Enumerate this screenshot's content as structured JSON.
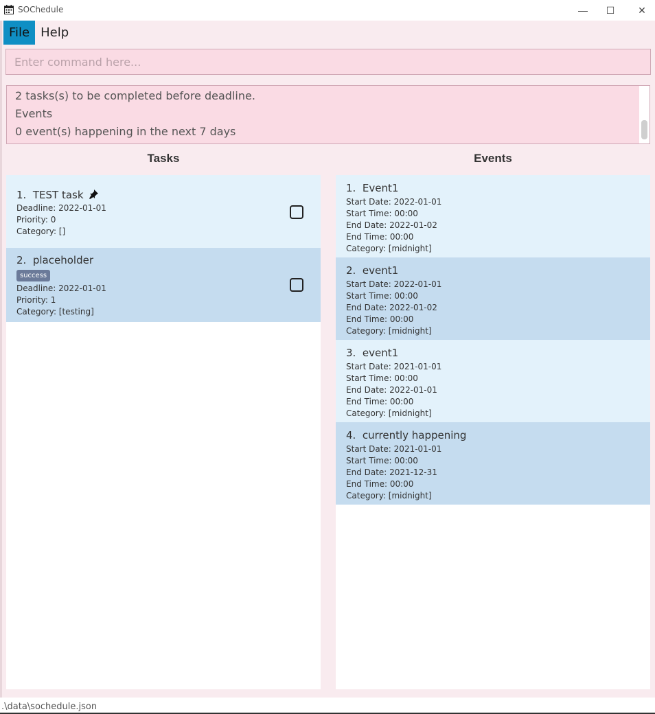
{
  "window": {
    "title": "SOChedule",
    "minimize": "—",
    "maximize": "☐",
    "close": "✕"
  },
  "menu": {
    "items": [
      {
        "label": "File"
      },
      {
        "label": "Help"
      }
    ]
  },
  "command": {
    "placeholder": "Enter command here...",
    "value": ""
  },
  "result": {
    "lines": [
      "2 tasks(s) to be completed before deadline.",
      "Events",
      "0 event(s) happening in the next 7 days"
    ]
  },
  "tasks": {
    "title": "Tasks",
    "items": [
      {
        "index": "1.",
        "name": "TEST task",
        "pinned": true,
        "tags": [],
        "deadline": "Deadline: 2022-01-01",
        "priority": "Priority: 0",
        "category": "Category: []"
      },
      {
        "index": "2.",
        "name": "placeholder",
        "pinned": false,
        "tags": [
          "success"
        ],
        "deadline": "Deadline: 2022-01-01",
        "priority": "Priority: 1",
        "category": "Category: [testing]"
      }
    ]
  },
  "events": {
    "title": "Events",
    "items": [
      {
        "index": "1.",
        "name": "Event1",
        "start_date": "Start Date: 2022-01-01",
        "start_time": "Start Time: 00:00",
        "end_date": "End Date: 2022-01-02",
        "end_time": "End Time: 00:00",
        "category": "Category: [midnight]"
      },
      {
        "index": "2.",
        "name": "event1",
        "start_date": "Start Date: 2022-01-01",
        "start_time": "Start Time: 00:00",
        "end_date": "End Date: 2022-01-02",
        "end_time": "End Time: 00:00",
        "category": "Category: [midnight]"
      },
      {
        "index": "3.",
        "name": "event1",
        "start_date": "Start Date: 2021-01-01",
        "start_time": "Start Time: 00:00",
        "end_date": "End Date: 2022-01-01",
        "end_time": "End Time: 00:00",
        "category": "Category: [midnight]"
      },
      {
        "index": "4.",
        "name": "currently happening",
        "start_date": "Start Date: 2021-01-01",
        "start_time": "Start Time: 00:00",
        "end_date": "End Date: 2021-12-31",
        "end_time": "End Time: 00:00",
        "category": "Category: [midnight]"
      }
    ]
  },
  "status": {
    "path": ".\\data\\sochedule.json"
  },
  "colors": {
    "menu_active": "#0f8fc4",
    "command_bg": "#fadbe4",
    "card_light": "#e3f2fb",
    "card_dark": "#c5dcef",
    "tag_bg": "#6b7a99",
    "window_bg": "#f9ebef"
  },
  "icons": {
    "app": "calendar-icon",
    "pin": "pushpin-icon"
  }
}
